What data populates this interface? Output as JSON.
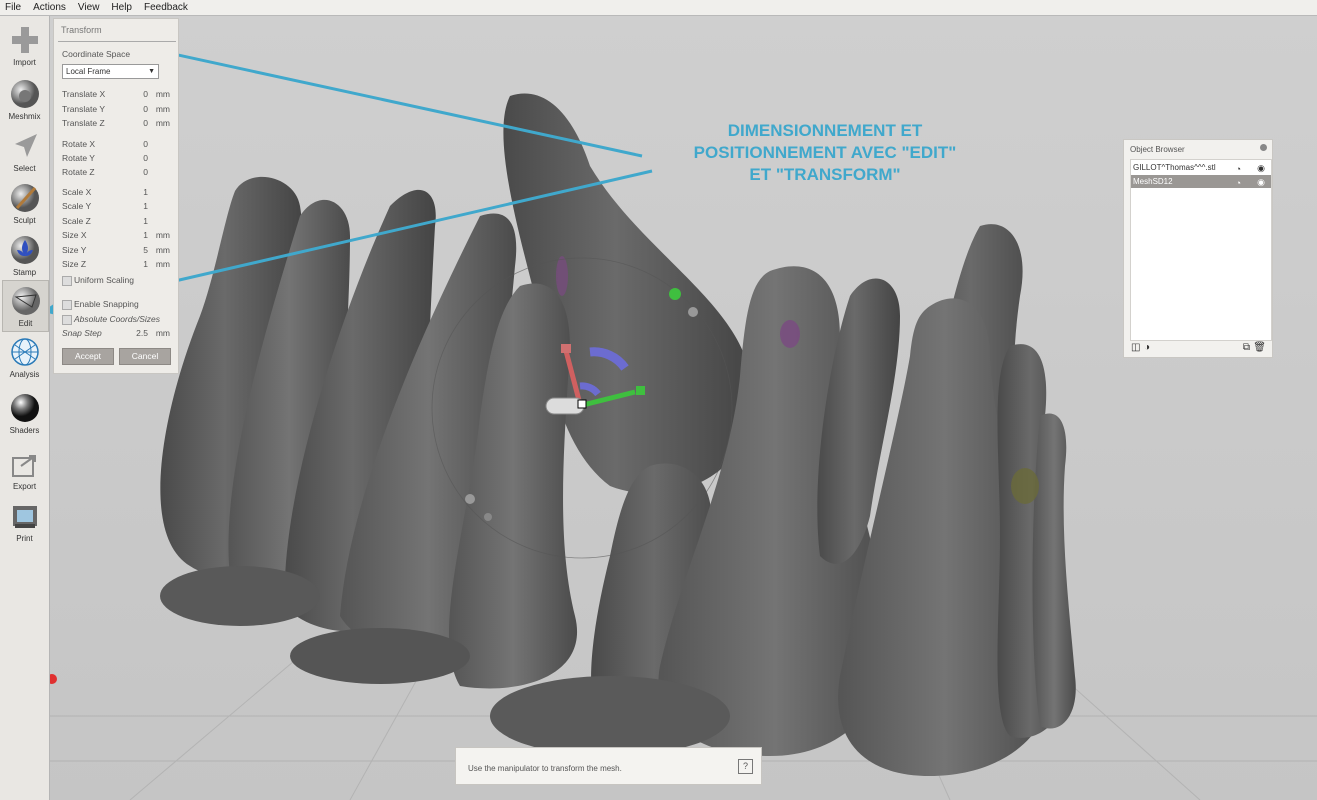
{
  "menu": [
    "File",
    "Actions",
    "View",
    "Help",
    "Feedback"
  ],
  "toolbar": [
    {
      "label": "Import",
      "icon": "plus-icon"
    },
    {
      "label": "Meshmix",
      "icon": "sphere-icon"
    },
    {
      "label": "Select",
      "icon": "arrow-cursor-icon"
    },
    {
      "label": "Sculpt",
      "icon": "brush-icon"
    },
    {
      "label": "Stamp",
      "icon": "fleur-de-lis-icon"
    },
    {
      "label": "Edit",
      "icon": "edit-sphere-icon",
      "active": true
    },
    {
      "label": "Analysis",
      "icon": "wire-sphere-icon"
    },
    {
      "label": "Shaders",
      "icon": "shaded-sphere-icon"
    },
    {
      "label": "Export",
      "icon": "export-icon"
    },
    {
      "label": "Print",
      "icon": "printer-icon"
    }
  ],
  "transform": {
    "title": "Transform",
    "coordinate_space_label": "Coordinate Space",
    "coordinate_space_value": "Local Frame",
    "rows": [
      {
        "label": "Translate X",
        "value": "0",
        "unit": "mm"
      },
      {
        "label": "Translate Y",
        "value": "0",
        "unit": "mm"
      },
      {
        "label": "Translate Z",
        "value": "0",
        "unit": "mm"
      },
      {
        "label": "Rotate X",
        "value": "0",
        "unit": ""
      },
      {
        "label": "Rotate Y",
        "value": "0",
        "unit": ""
      },
      {
        "label": "Rotate Z",
        "value": "0",
        "unit": ""
      },
      {
        "label": "Scale X",
        "value": "1",
        "unit": ""
      },
      {
        "label": "Scale Y",
        "value": "1",
        "unit": ""
      },
      {
        "label": "Scale Z",
        "value": "1",
        "unit": ""
      },
      {
        "label": "Size X",
        "value": "1",
        "unit": "mm"
      },
      {
        "label": "Size Y",
        "value": "5",
        "unit": "mm"
      },
      {
        "label": "Size Z",
        "value": "1",
        "unit": "mm"
      }
    ],
    "uniform_scaling": "Uniform Scaling",
    "enable_snapping": "Enable Snapping",
    "absolute_coords": "Absolute Coords/Sizes",
    "snap_step_label": "Snap Step",
    "snap_step_value": "2.5",
    "snap_step_unit": "mm",
    "accept": "Accept",
    "cancel": "Cancel"
  },
  "object_browser": {
    "title": "Object Browser",
    "items": [
      {
        "name": "GILLOT^Thomas^^^.stl",
        "selected": false
      },
      {
        "name": "MeshSD12",
        "selected": true
      }
    ]
  },
  "status_message": "Use the manipulator to transform the mesh.",
  "help_label": "?",
  "annotation": [
    "DIMENSIONNEMENT ET",
    "POSITIONNEMENT AVEC \"EDIT\"",
    "ET \"TRANSFORM\""
  ],
  "colors": {
    "annotation": "#40a8cc",
    "mesh": "#5e5e5e",
    "accent_green": "#3fbf3f",
    "accent_red": "#d06060",
    "accent_blue": "#6c6cd0"
  }
}
